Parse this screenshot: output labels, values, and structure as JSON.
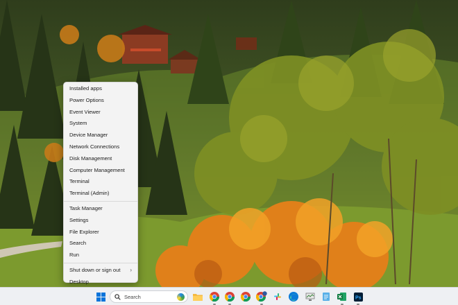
{
  "menu": {
    "items": [
      {
        "label": "Installed apps"
      },
      {
        "label": "Power Options"
      },
      {
        "label": "Event Viewer"
      },
      {
        "label": "System"
      },
      {
        "label": "Device Manager"
      },
      {
        "label": "Network Connections"
      },
      {
        "label": "Disk Management"
      },
      {
        "label": "Computer Management"
      },
      {
        "label": "Terminal"
      },
      {
        "label": "Terminal (Admin)"
      },
      {
        "label": "Task Manager"
      },
      {
        "label": "Settings"
      },
      {
        "label": "File Explorer"
      },
      {
        "label": "Search"
      },
      {
        "label": "Run"
      },
      {
        "label": "Shut down or sign out"
      },
      {
        "label": "Desktop"
      }
    ],
    "submenu_chevron": "›"
  },
  "taskbar": {
    "search_placeholder": "Search",
    "icons": [
      "windows-start-icon",
      "search-icon",
      "copilot-icon",
      "file-explorer-icon",
      "chrome-icon",
      "chrome-icon",
      "chrome-icon",
      "chrome-profile-icon",
      "slack-icon",
      "edge-icon",
      "network-monitor-icon",
      "notepad-icon",
      "excel-icon",
      "photoshop-icon"
    ],
    "colors": {
      "background": "#eef0f3",
      "accent": "#0067c0"
    }
  }
}
